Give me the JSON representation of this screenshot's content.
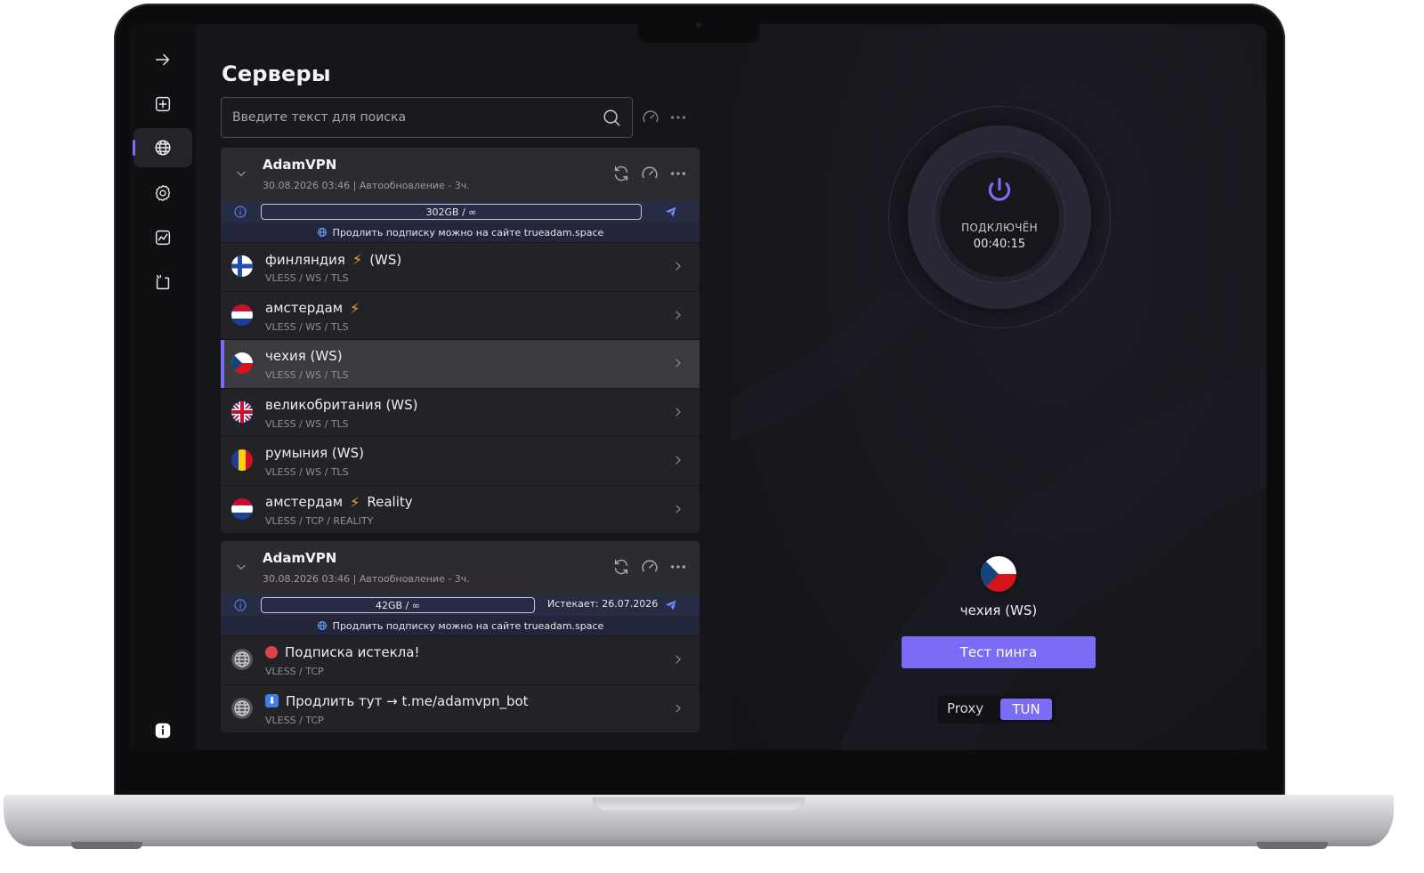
{
  "sidebar": {
    "items": [
      {
        "icon": "arrow-right-icon"
      },
      {
        "icon": "add-profile-icon"
      },
      {
        "icon": "globe-icon",
        "active": true
      },
      {
        "icon": "settings-gear-icon"
      },
      {
        "icon": "activity-chart-icon"
      },
      {
        "icon": "logs-icon"
      }
    ],
    "bottom_icon": "info-icon"
  },
  "servers_page": {
    "title": "Серверы",
    "search_placeholder": "Введите текст для поиска"
  },
  "groups": [
    {
      "name": "AdamVPN",
      "subtitle": "30.08.2026 03:46 | Автообновление - 3ч.",
      "traffic": "302GB / ∞",
      "expires": "",
      "promo": "Продлить подписку можно на сайте trueadam.space",
      "servers": [
        {
          "name": "финляндия",
          "bolt": true,
          "suffix": "(WS)",
          "protocol": "VLESS / WS / TLS",
          "flag": "finland"
        },
        {
          "name": "амстердам",
          "bolt": true,
          "suffix": "",
          "protocol": "VLESS / WS / TLS",
          "flag": "netherlands"
        },
        {
          "name": "чехия (WS)",
          "bolt": false,
          "suffix": "",
          "protocol": "VLESS / WS / TLS",
          "flag": "czech",
          "selected": true
        },
        {
          "name": "великобритания (WS)",
          "bolt": false,
          "suffix": "",
          "protocol": "VLESS / WS / TLS",
          "flag": "uk"
        },
        {
          "name": "румыния (WS)",
          "bolt": false,
          "suffix": "",
          "protocol": "VLESS / WS / TLS",
          "flag": "romania"
        },
        {
          "name": "амстердам",
          "bolt": true,
          "suffix": "Reality",
          "protocol": "VLESS / TCP / REALITY",
          "flag": "netherlands"
        }
      ]
    },
    {
      "name": "AdamVPN",
      "subtitle": "30.08.2026 03:46 | Автообновление - 3ч.",
      "traffic": "42GB / ∞",
      "expires": "Истекает: 26.07.2026",
      "promo": "Продлить подписку можно на сайте trueadam.space",
      "servers": [
        {
          "name": "Подписка истекла!",
          "marker": "red-dot",
          "protocol": "VLESS / TCP",
          "flag": "globe"
        },
        {
          "name": "Продлить тут → t.me/adamvpn_bot",
          "marker": "down-arrow",
          "protocol": "VLESS / TCP",
          "flag": "globe"
        }
      ]
    }
  ],
  "connection": {
    "status": "ПОДКЛЮЧЁН",
    "timer": "00:40:15",
    "current_server": "чехия (WS)",
    "current_flag": "czech",
    "ping_button": "Тест пинга",
    "mode_proxy": "Proxy",
    "mode_tun": "TUN",
    "active_mode": "TUN"
  },
  "colors": {
    "accent": "#7b6cf6",
    "bolt": "#f5a623",
    "info": "#5b7cf2"
  }
}
